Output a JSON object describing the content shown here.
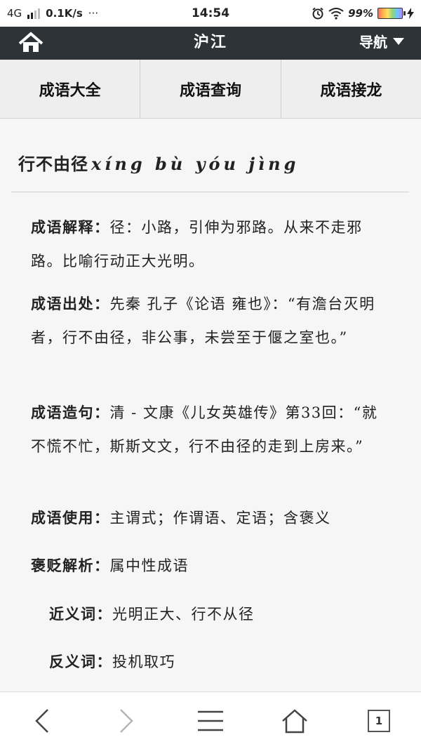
{
  "status_bar": {
    "network": "4G",
    "speed": "0.1K/s",
    "more": "···",
    "time": "14:54",
    "battery": "99%"
  },
  "header": {
    "title": "沪江",
    "nav_label": "导航",
    "home_icon": "home-icon",
    "dropdown_icon": "chevron-down-icon"
  },
  "tabs": [
    {
      "label": "成语大全"
    },
    {
      "label": "成语查询"
    },
    {
      "label": "成语接龙"
    }
  ],
  "idiom": {
    "title": "行不由径",
    "pinyin": "xíng bù yóu jìng"
  },
  "sections": {
    "explanation": {
      "label": "成语解释：",
      "text": "径：小路，引伸为邪路。从来不走邪路。比喻行动正大光明。"
    },
    "source": {
      "label": "成语出处：",
      "text": "先秦 孔子《论语 雍也》：“有澹台灭明者，行不由径，非公事，未尝至于偃之室也。”"
    },
    "example": {
      "label": "成语造句：",
      "text": "清 - 文康《儿女英雄传》第33回：“就不慌不忙，斯斯文文，行不由径的走到上房来。”"
    },
    "usage": {
      "label": "成语使用：",
      "text": "主谓式；作谓语、定语；含褒义"
    },
    "sentiment": {
      "label": "褒贬解析：",
      "text": "属中性成语"
    },
    "synonyms": {
      "label": "近义词：",
      "text": "光明正大、行不从径"
    },
    "antonyms": {
      "label": "反义词：",
      "text": "投机取巧"
    }
  },
  "bottom_bar": {
    "tab_count": "1",
    "icons": [
      "back-icon",
      "forward-icon",
      "menu-icon",
      "home-icon",
      "tabs-icon"
    ]
  },
  "colors": {
    "header_bg": "#2d3337",
    "tab_bg": "#eeeeee",
    "content_bg": "#f6f6f6"
  }
}
